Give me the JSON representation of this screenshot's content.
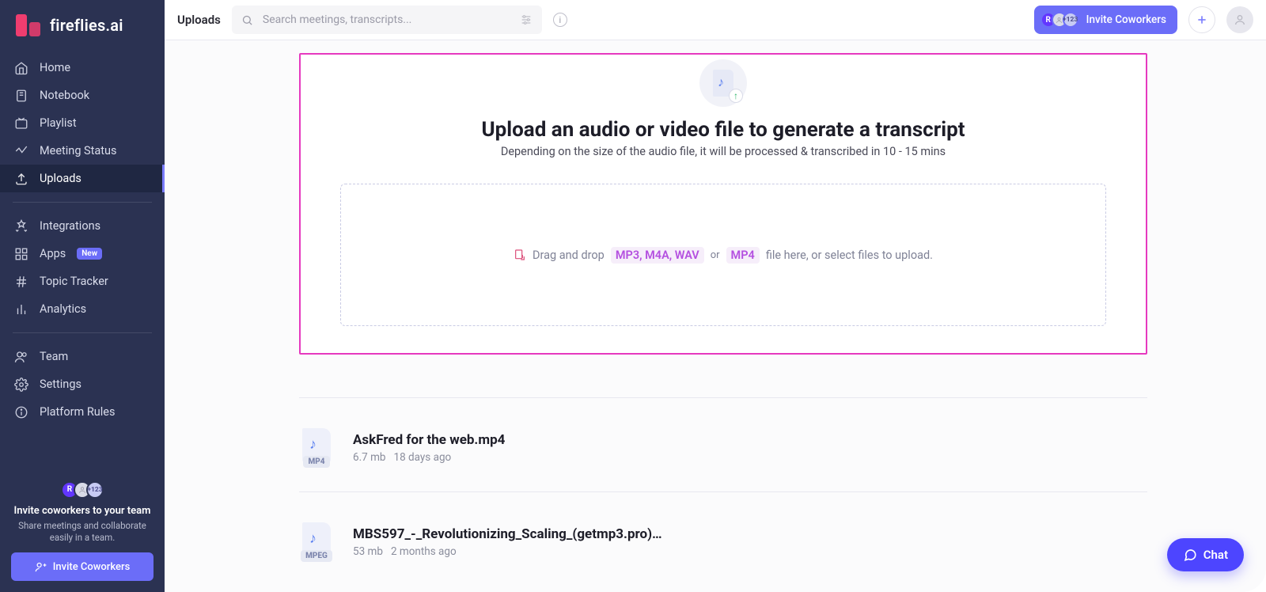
{
  "brand": "fireflies.ai",
  "header": {
    "title": "Uploads",
    "search_placeholder": "Search meetings, transcripts...",
    "invite_label": "Invite Coworkers",
    "avatar_badge": "+123"
  },
  "sidebar": {
    "items": [
      {
        "icon": "home",
        "label": "Home"
      },
      {
        "icon": "notebook",
        "label": "Notebook"
      },
      {
        "icon": "playlist",
        "label": "Playlist"
      },
      {
        "icon": "status",
        "label": "Meeting Status"
      },
      {
        "icon": "upload",
        "label": "Uploads"
      }
    ],
    "items2": [
      {
        "icon": "integrations",
        "label": "Integrations"
      },
      {
        "icon": "apps",
        "label": "Apps",
        "badge": "New"
      },
      {
        "icon": "topic",
        "label": "Topic Tracker"
      },
      {
        "icon": "analytics",
        "label": "Analytics"
      }
    ],
    "items3": [
      {
        "icon": "team",
        "label": "Team"
      },
      {
        "icon": "settings",
        "label": "Settings"
      },
      {
        "icon": "rules",
        "label": "Platform Rules"
      }
    ],
    "invite": {
      "title": "Invite coworkers to your team",
      "subtitle": "Share meetings and collaborate easily in a team.",
      "button": "Invite Coworkers",
      "badge": "+123"
    }
  },
  "upload": {
    "heading": "Upload an audio or video file to generate a transcript",
    "subheading": "Depending on the size of the audio file, it will be processed & transcribed in 10 - 15 mins",
    "drop_pre": "Drag and drop",
    "formats_audio": "MP3, M4A, WAV",
    "or": "or",
    "formats_video": "MP4",
    "drop_post": "file here, or select files to upload."
  },
  "files": [
    {
      "name": "AskFred for the web.mp4",
      "size": "6.7 mb",
      "age": "18 days ago",
      "ext": "MP4"
    },
    {
      "name": "MBS597_-_Revolutionizing_Scaling_(getmp3.pro)…",
      "size": "53 mb",
      "age": "2 months ago",
      "ext": "MPEG"
    }
  ],
  "chat": {
    "label": "Chat"
  }
}
